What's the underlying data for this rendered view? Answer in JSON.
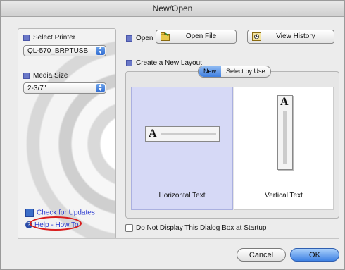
{
  "window": {
    "title": "New/Open"
  },
  "sidebar": {
    "select_printer_label": "Select Printer",
    "printer_value": "QL-570_BRPTUSB",
    "media_size_label": "Media Size",
    "media_value": "2-3/7\"",
    "check_updates": "Check for Updates",
    "help": "Help - How To"
  },
  "open_row": {
    "label": "Open",
    "open_file": "Open File",
    "view_history": "View History"
  },
  "layout": {
    "label": "Create a New Layout",
    "tabs": [
      "New",
      "Select by Use"
    ],
    "horizontal": "Horizontal Text",
    "vertical": "Vertical Text",
    "glyph": "A"
  },
  "startup_checkbox": "Do Not Display This Dialog Box at Startup",
  "buttons": {
    "cancel": "Cancel",
    "ok": "OK"
  },
  "colors": {
    "accent": "#3f7fe0",
    "help_circle": "#d81b1b",
    "selected_card": "#d6d9f6"
  }
}
